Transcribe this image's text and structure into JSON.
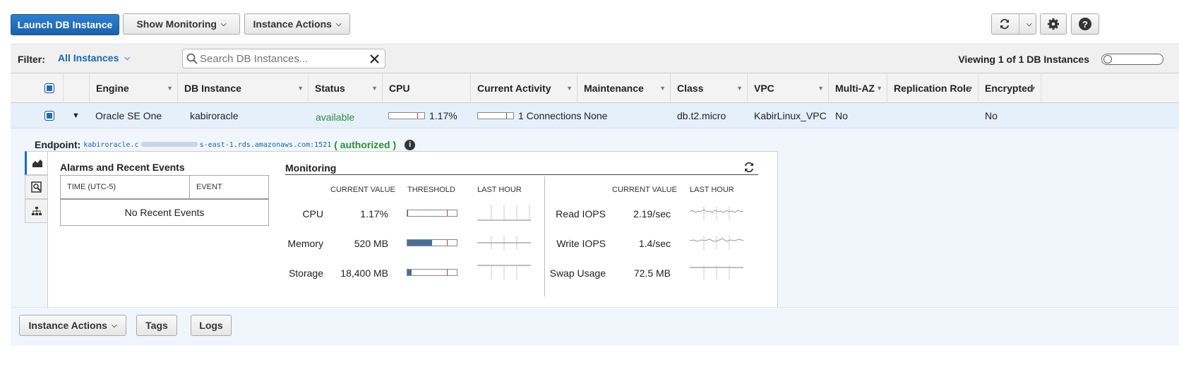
{
  "toolbar": {
    "launch_label": "Launch DB Instance",
    "monitoring_label": "Show Monitoring",
    "actions_label": "Instance Actions"
  },
  "filter": {
    "label": "Filter:",
    "selected": "All Instances",
    "search_placeholder": "Search DB Instances...",
    "viewing": "Viewing 1 of 1 DB Instances"
  },
  "table": {
    "columns": [
      "Engine",
      "DB Instance",
      "Status",
      "CPU",
      "Current Activity",
      "Maintenance",
      "Class",
      "VPC",
      "Multi-AZ",
      "Replication Role",
      "Encrypted"
    ],
    "row": {
      "engine": "Oracle SE One",
      "db_instance": "kabiroracle",
      "status": "available",
      "cpu": "1.17%",
      "activity": "1 Connections",
      "maintenance": "None",
      "class": "db.t2.micro",
      "vpc": "KabirLinux_VPC",
      "multi_az": "No",
      "replication_role": "",
      "encrypted": "No"
    }
  },
  "detail": {
    "endpoint_label": "Endpoint:",
    "endpoint_start": "kabiroracle.c",
    "endpoint_end": "s-east-1.rds.amazonaws.com:1521",
    "auth_open": "(",
    "auth_status": "authorized",
    "auth_close": ")",
    "events_title": "Alarms and Recent Events",
    "events_col_time": "TIME (UTC-5)",
    "events_col_event": "EVENT",
    "events_empty": "No Recent Events",
    "monitoring_title": "Monitoring",
    "col_current": "CURRENT VALUE",
    "col_threshold": "THRESHOLD",
    "col_lasthour": "LAST HOUR",
    "left_metrics": [
      {
        "label": "CPU",
        "value": "1.17%",
        "fill": 0.0117
      },
      {
        "label": "Memory",
        "value": "520 MB",
        "fill": 0.5
      },
      {
        "label": "Storage",
        "value": "18,400 MB",
        "fill": 0.08
      }
    ],
    "right_metrics": [
      {
        "label": "Read IOPS",
        "value": "2.19/sec"
      },
      {
        "label": "Write IOPS",
        "value": "1.4/sec"
      },
      {
        "label": "Swap Usage",
        "value": "72.5 MB"
      }
    ]
  },
  "footer": {
    "actions_label": "Instance Actions",
    "tags_label": "Tags",
    "logs_label": "Logs"
  },
  "colors": {
    "primary": "#1b6ac9",
    "available": "#2a9134",
    "link": "#1a64b3"
  }
}
